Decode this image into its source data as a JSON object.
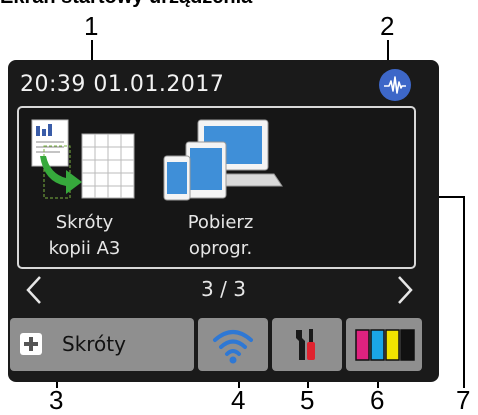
{
  "caption": "Ekran startowy urządzenia",
  "callouts": [
    "1",
    "2",
    "3",
    "4",
    "5",
    "6",
    "7"
  ],
  "status_bar": {
    "datetime": "20:39   01.01.2017"
  },
  "apps": [
    {
      "label_line1": "Skróty",
      "label_line2": "kopii A3",
      "icon": "a3-copy-shortcut-icon"
    },
    {
      "label_line1": "Pobierz",
      "label_line2": "oprogr.",
      "icon": "download-software-icon"
    }
  ],
  "pager": {
    "text": "3 / 3"
  },
  "toolbar": {
    "shortcuts_label": "Skróty"
  },
  "colors": {
    "screen_bg": "#1a1a1a",
    "button_bg": "#8f8f8f",
    "wireless_blue": "#2f78d4",
    "ink_cyan": "#1aa6e6",
    "ink_magenta": "#e0227f",
    "ink_yellow": "#f2e400",
    "ink_black": "#111111"
  }
}
